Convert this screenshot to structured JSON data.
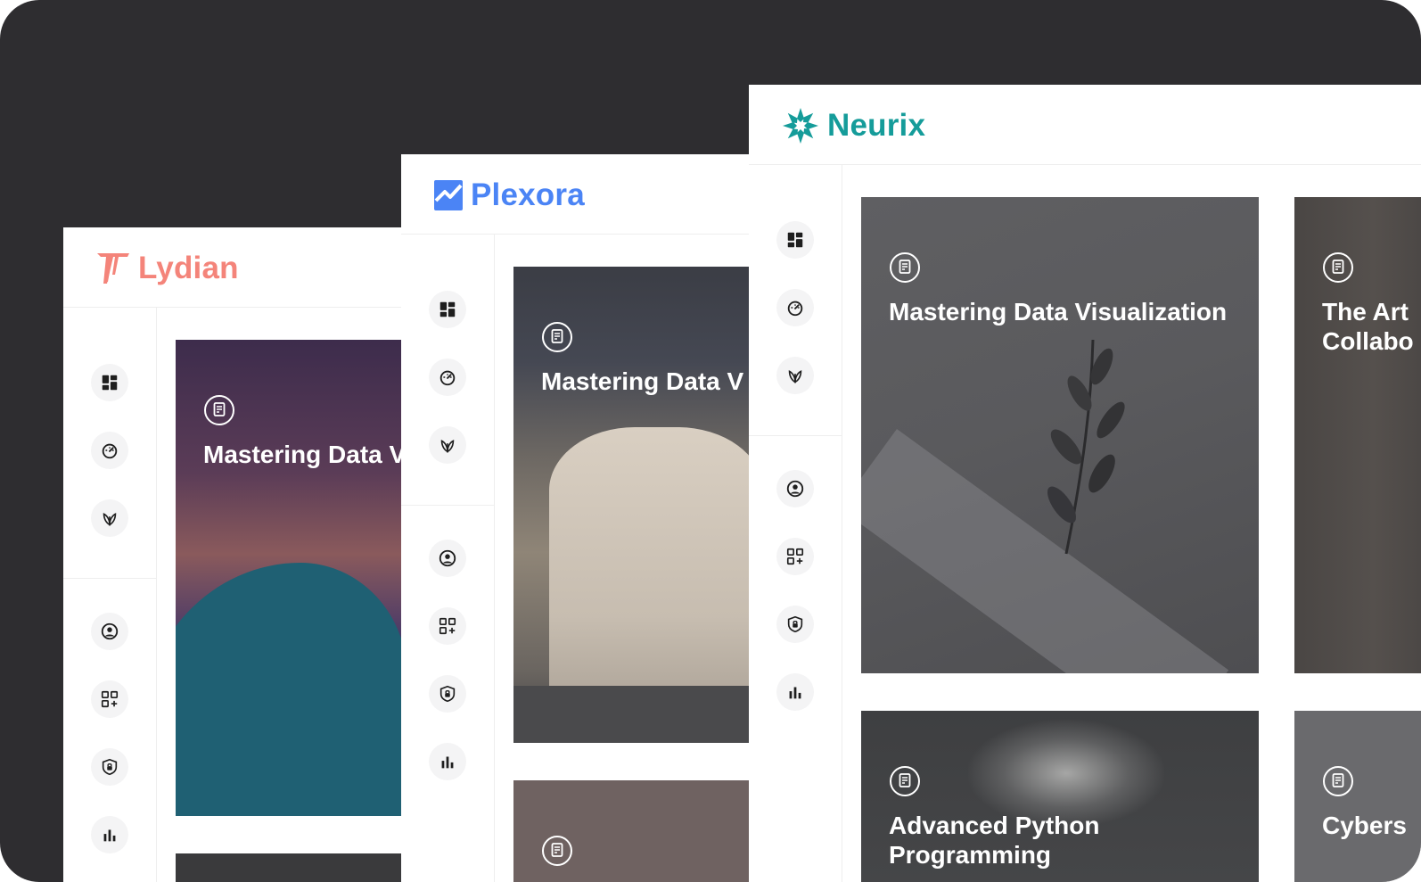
{
  "colors": {
    "backdrop": "#2e2d30",
    "lydian_brand": "#f4847a",
    "plexora_brand": "#4b84f5",
    "neurix_brand": "#159c9a",
    "sidebar_icon": "#1e1e1e"
  },
  "sidebar_icons": [
    "dashboard-icon",
    "gauge-icon",
    "plant-icon",
    "user-circle-icon",
    "add-app-icon",
    "shield-lock-icon",
    "bar-chart-icon"
  ],
  "windows": {
    "lydian": {
      "brand": "Lydian",
      "cards": [
        {
          "title": "Mastering Data V"
        }
      ]
    },
    "plexora": {
      "brand": "Plexora",
      "cards": [
        {
          "title": "Mastering Data V"
        }
      ]
    },
    "neurix": {
      "brand": "Neurix",
      "cards": [
        {
          "title": "Mastering Data Visualization"
        },
        {
          "title_lines": [
            "The Art",
            "Collabo"
          ]
        },
        {
          "title_lines": [
            "Advanced Python",
            "Programming"
          ]
        },
        {
          "title": "Cybers"
        }
      ]
    }
  }
}
